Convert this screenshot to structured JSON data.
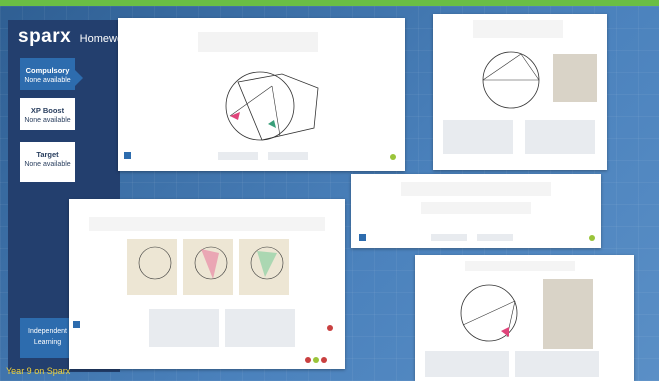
{
  "brand": {
    "logo": "sparx",
    "section": "Homework"
  },
  "tasks": [
    {
      "title": "Compulsory",
      "status": "None available",
      "active": true
    },
    {
      "title": "XP Boost",
      "status": "None available",
      "active": false
    },
    {
      "title": "Target",
      "status": "None available",
      "active": false
    }
  ],
  "independent": {
    "line1": "Independent",
    "line2": "Learning"
  },
  "caption": "Year 9 on Sparx",
  "colors": {
    "accent_green": "#6abe45",
    "sidebar": "#233f6e",
    "tab_blue": "#2d6cae",
    "caption_yellow": "#f0d23a"
  }
}
